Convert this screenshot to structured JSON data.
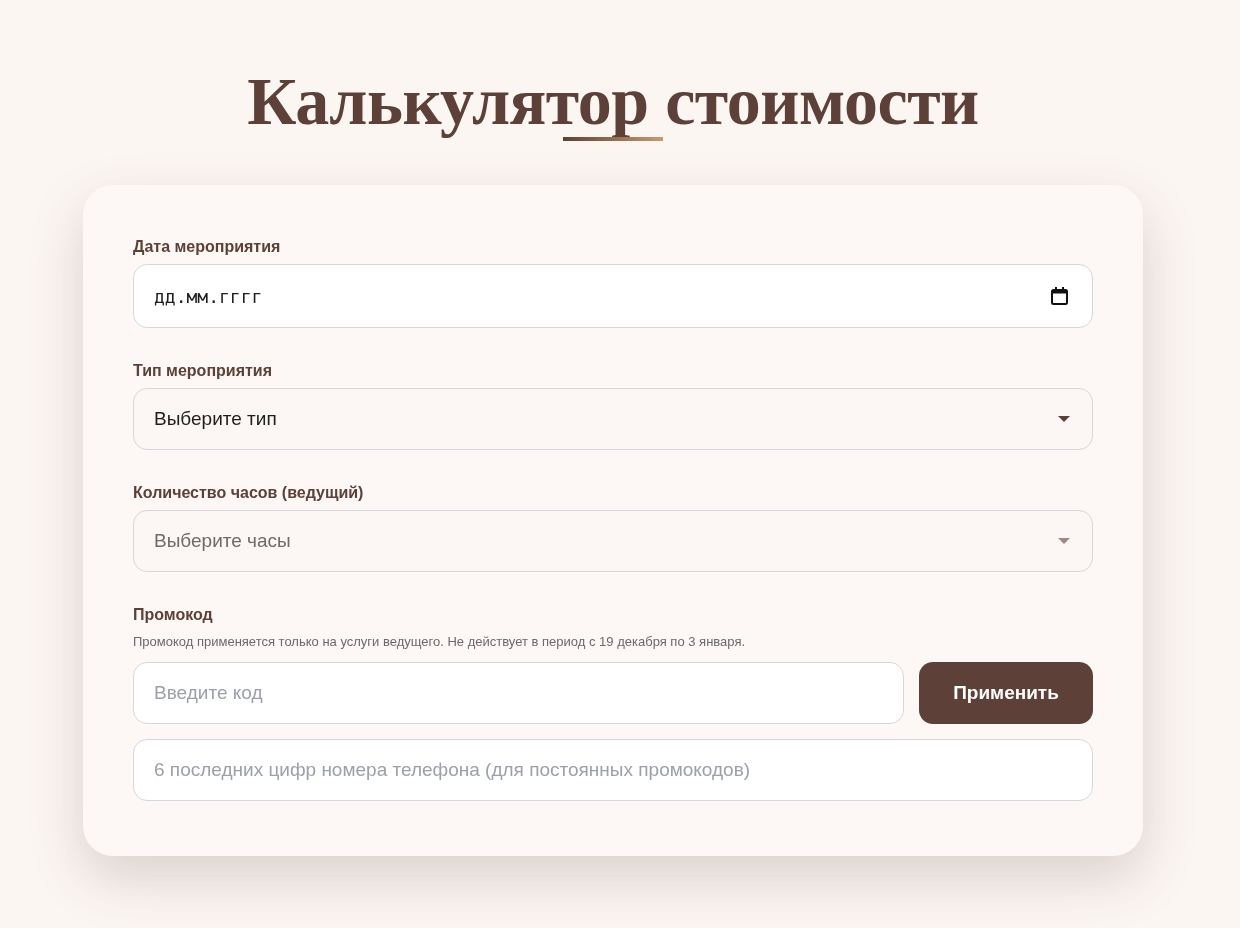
{
  "title": "Калькулятор стоимости",
  "form": {
    "fields": [
      {
        "kind": "date",
        "label": "Дата мероприятия",
        "placeholder": "дд.мм.гггг"
      },
      {
        "kind": "select",
        "label": "Тип мероприятия",
        "value": "Выберите тип",
        "disabled": false
      },
      {
        "kind": "select",
        "label": "Количество часов (ведущий)",
        "value": "Выберите часы",
        "disabled": true
      },
      {
        "kind": "promo",
        "label": "Промокод",
        "hint": "Промокод применяется только на услуги ведущего. Не действует в период с 19 декабря по 3 января.",
        "placeholder": "Введите код",
        "button": "Применить"
      },
      {
        "kind": "text",
        "placeholder": "6 последних цифр номера телефона (для постоянных промокодов)"
      }
    ]
  }
}
